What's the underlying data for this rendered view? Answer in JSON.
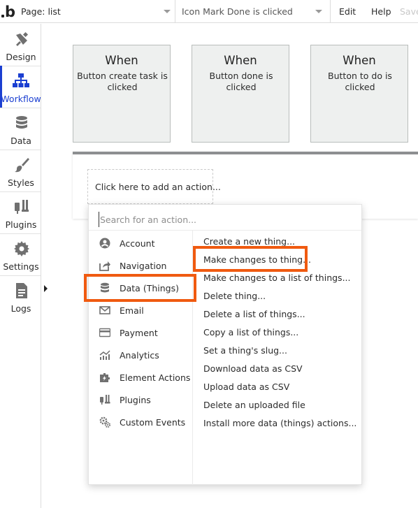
{
  "topbar": {
    "logo": "b",
    "page_selector": "Page: list",
    "event_selector": "Icon Mark Done is clicked",
    "menu": {
      "edit": "Edit",
      "help": "Help",
      "save": "Save"
    }
  },
  "sidebar": {
    "items": [
      {
        "label": "Design",
        "icon": "design-icon"
      },
      {
        "label": "Workflow",
        "icon": "workflow-icon",
        "active": true
      },
      {
        "label": "Data",
        "icon": "database-icon"
      },
      {
        "label": "Styles",
        "icon": "brush-icon"
      },
      {
        "label": "Plugins",
        "icon": "plug-icon"
      },
      {
        "label": "Settings",
        "icon": "gear-icon"
      },
      {
        "label": "Logs",
        "icon": "document-icon"
      }
    ]
  },
  "events": [
    {
      "title": "When",
      "subtitle": "Button create task is clicked"
    },
    {
      "title": "When",
      "subtitle": "Button done is clicked"
    },
    {
      "title": "When",
      "subtitle": "Button to do is clicked"
    }
  ],
  "add_action": {
    "label": "Click here to add an action..."
  },
  "action_panel": {
    "search_placeholder": "Search for an action...",
    "categories": [
      {
        "label": "Account",
        "icon": "account-icon"
      },
      {
        "label": "Navigation",
        "icon": "navigation-icon"
      },
      {
        "label": "Data (Things)",
        "icon": "database-icon",
        "highlighted": true
      },
      {
        "label": "Email",
        "icon": "email-icon"
      },
      {
        "label": "Payment",
        "icon": "payment-icon"
      },
      {
        "label": "Analytics",
        "icon": "analytics-icon"
      },
      {
        "label": "Element Actions",
        "icon": "element-actions-icon"
      },
      {
        "label": "Plugins",
        "icon": "plug-icon"
      },
      {
        "label": "Custom Events",
        "icon": "gears-icon"
      }
    ],
    "actions": [
      {
        "label": "Create a new thing..."
      },
      {
        "label": "Make changes to thing...",
        "highlighted": true
      },
      {
        "label": "Make changes to a list of things..."
      },
      {
        "label": "Delete thing..."
      },
      {
        "label": "Delete a list of things..."
      },
      {
        "label": "Copy a list of things..."
      },
      {
        "label": "Set a thing's slug..."
      },
      {
        "label": "Download data as CSV"
      },
      {
        "label": "Upload data as CSV"
      },
      {
        "label": "Delete an uploaded file"
      },
      {
        "label": "Install more data (things) actions..."
      }
    ]
  },
  "colors": {
    "accent": "#1b3fd1",
    "highlight": "#f05a10",
    "icon_gray": "#707070",
    "card_bg": "#eef0ef"
  }
}
